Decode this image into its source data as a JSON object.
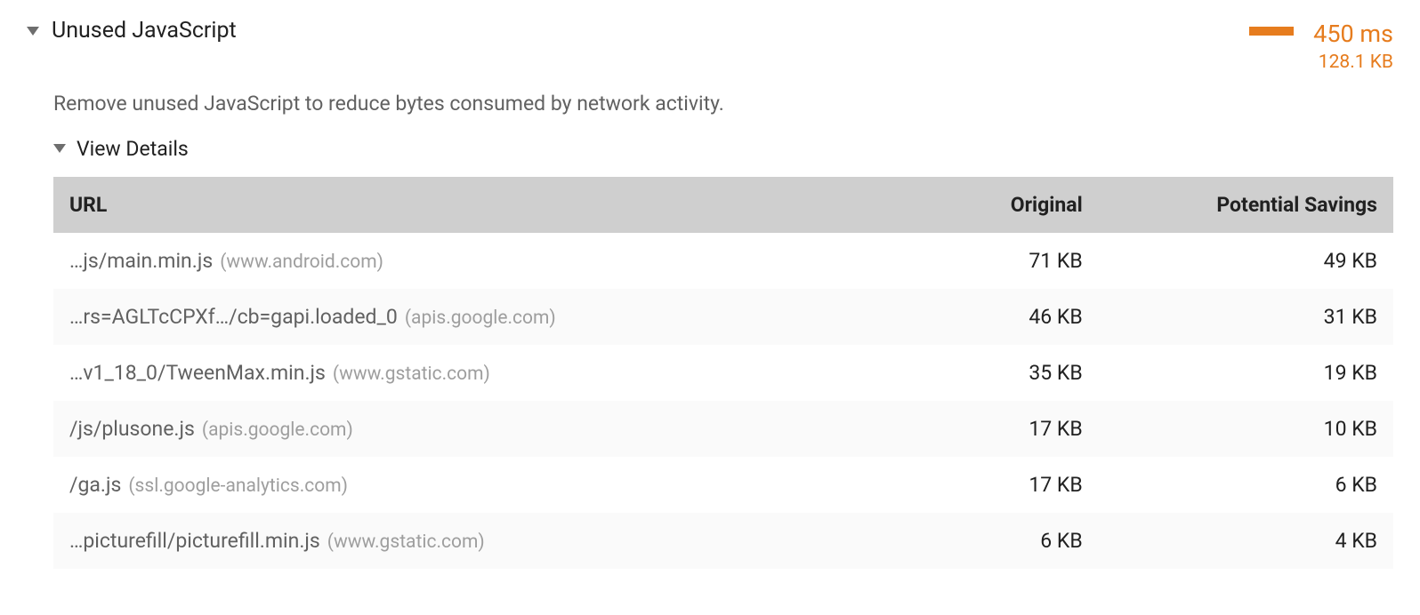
{
  "audit": {
    "title": "Unused JavaScript",
    "description": "Remove unused JavaScript to reduce bytes consumed by network activity.",
    "metric_time": "450 ms",
    "metric_size": "128.1 KB",
    "metric_color": "#e67c1e"
  },
  "details": {
    "toggle_label": "View Details"
  },
  "table": {
    "headers": {
      "url": "URL",
      "original": "Original",
      "savings": "Potential Savings"
    },
    "rows": [
      {
        "path": "…js/main.min.js",
        "host": "(www.android.com)",
        "original": "71 KB",
        "savings": "49 KB"
      },
      {
        "path": "…rs=AGLTcCPXf…/cb=gapi.loaded_0",
        "host": "(apis.google.com)",
        "original": "46 KB",
        "savings": "31 KB"
      },
      {
        "path": "…v1_18_0/TweenMax.min.js",
        "host": "(www.gstatic.com)",
        "original": "35 KB",
        "savings": "19 KB"
      },
      {
        "path": "/js/plusone.js",
        "host": "(apis.google.com)",
        "original": "17 KB",
        "savings": "10 KB"
      },
      {
        "path": "/ga.js",
        "host": "(ssl.google-analytics.com)",
        "original": "17 KB",
        "savings": "6 KB"
      },
      {
        "path": "…picturefill/picturefill.min.js",
        "host": "(www.gstatic.com)",
        "original": "6 KB",
        "savings": "4 KB"
      }
    ]
  }
}
